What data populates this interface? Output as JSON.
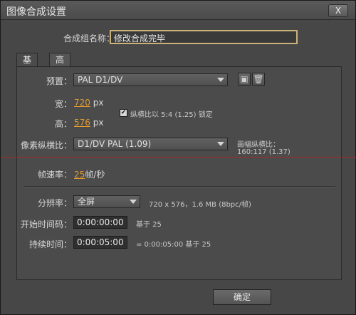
{
  "window": {
    "title": "图像合成设置",
    "close_glyph": "X"
  },
  "composition_name": {
    "label": "合成组名称：",
    "value": "修改合成完毕"
  },
  "tabs": [
    "基本",
    "高级"
  ],
  "preset": {
    "label": "预置：",
    "value": "PAL D1/DV"
  },
  "size": {
    "width_label": "宽：",
    "width_value": "720",
    "height_label": "高：",
    "height_value": "576",
    "unit": "px",
    "lock_ratio_label": "纵横比以 5:4 (1.25) 锁定",
    "lock_checked": true
  },
  "pixel_aspect": {
    "label": "像素纵横比：",
    "value": "D1/DV PAL (1.09)",
    "frame_aspect_label": "画幅纵横比：",
    "frame_aspect_value": "160:117 (1.37)"
  },
  "frame_rate": {
    "label": "帧速率：",
    "value": "25",
    "unit": "帧/秒"
  },
  "resolution": {
    "label": "分辨率：",
    "value": "全屏",
    "info": "720 x 576，1.6 MB (8bpc/帧)"
  },
  "start_timecode": {
    "label": "开始时间码：",
    "value": "0:00:00:00",
    "base": "基于 25"
  },
  "duration": {
    "label": "持续时间：",
    "value": "0:00:05:00",
    "info": "= 0:00:05:00  基于 25"
  },
  "buttons": {
    "ok": "确定"
  },
  "icons": {
    "save": "save-preset-icon",
    "delete": "trash-icon"
  }
}
